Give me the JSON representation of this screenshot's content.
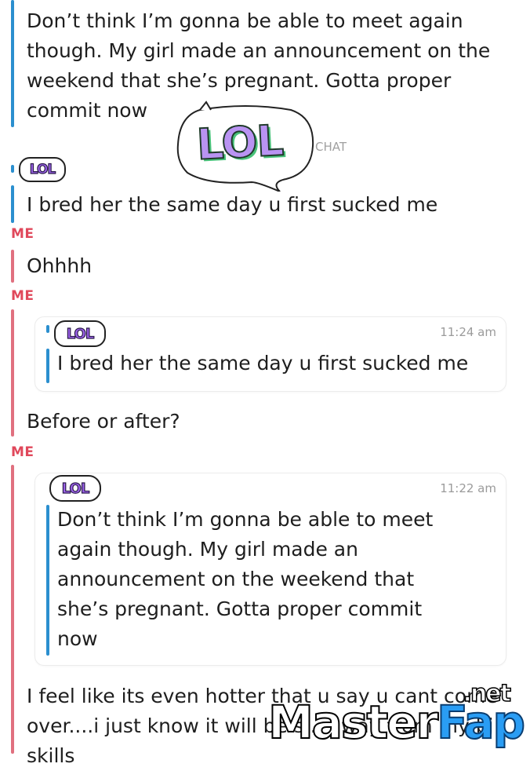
{
  "messages": {
    "m1_text": "Don’t think I’m gonna be able to meet again though. My girl made an announcement on the weekend that she’s pregnant. Gotta proper commit now",
    "chat_label": "CHAT",
    "m2_text": "I bred her the same day u first sucked me",
    "me_label_1": "ME",
    "m3_text": "Ohhhh",
    "me_label_2": "ME",
    "quote1_time": "11:24 am",
    "quote1_text": "I bred her the same day u first sucked me",
    "m4_text": "Before or after?",
    "me_label_3": "ME",
    "quote2_time": "11:22 am",
    "quote2_text": "Don’t think I’m gonna be able to meet again though. My girl made an announcement on the weekend that she’s pregnant. Gotta proper commit now",
    "m5_text": "I feel like its even hotter that u say u cant come over....i just know it will be s... away from my bj skills"
  },
  "stickers": {
    "big_lol": "LOL",
    "small_lol": "LOL"
  },
  "watermark": {
    "master": "Master",
    "fap": "Fap",
    "net": ".net"
  },
  "colors": {
    "friend_bar": "#2b8fcf",
    "me_bar": "#e0707f",
    "me_label": "#e0485b",
    "lol_fill": "#9b62e8"
  }
}
